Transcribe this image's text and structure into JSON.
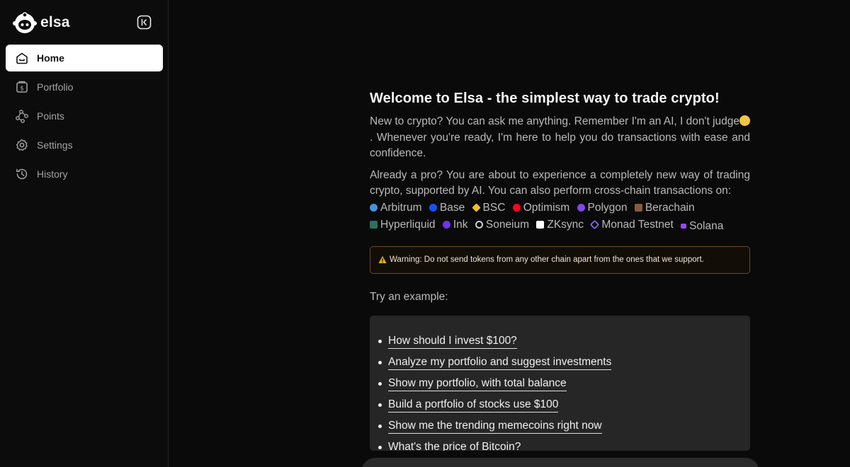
{
  "app": {
    "name": "elsa"
  },
  "sidebar": {
    "items": [
      {
        "label": "Home",
        "icon": "home-icon",
        "active": true
      },
      {
        "label": "Portfolio",
        "icon": "wallet-dollar-icon",
        "active": false
      },
      {
        "label": "Points",
        "icon": "network-nodes-icon",
        "active": false
      },
      {
        "label": "Settings",
        "icon": "gear-icon",
        "active": false
      },
      {
        "label": "History",
        "icon": "history-clock-icon",
        "active": false
      }
    ]
  },
  "main": {
    "welcome_title": "Welcome to Elsa - the simplest way to trade crypto!",
    "para1_text": "New to crypto? You can ask me anything. Remember I'm an AI, I don't judge",
    "para1_text_end": ". Whenever you're ready, I'm here to help you do transactions with ease and confidence.",
    "para2_text": "Already a pro? You are about to experience a completely new way of trading crypto, supported by AI. You can also perform cross-chain transactions on:",
    "chains": [
      {
        "name": "Arbitrum",
        "color": "#4a90d9"
      },
      {
        "name": "Base",
        "color": "#1652f0"
      },
      {
        "name": "BSC",
        "color": "#f3ba2f"
      },
      {
        "name": "Optimism",
        "color": "#ff0420"
      },
      {
        "name": "Polygon",
        "color": "#8247e5"
      },
      {
        "name": "Berachain",
        "color": "#8a5a3c"
      },
      {
        "name": "Hyperliquid",
        "color": "#2e6f5e"
      },
      {
        "name": "Ink",
        "color": "#7132f5"
      },
      {
        "name": "Soneium",
        "color": "#cccccc"
      },
      {
        "name": "ZKsync",
        "color": "#ffffff"
      },
      {
        "name": "Monad Testnet",
        "color": "#836ef9"
      },
      {
        "name": "Solana",
        "color": "#9945ff"
      }
    ],
    "warning": "Warning: Do not send tokens from any other chain apart from the ones that we support.",
    "try_label": "Try an example:",
    "examples": [
      "How should I invest $100?",
      "Analyze my portfolio and suggest investments",
      "Show my portfolio, with total balance",
      "Build a portfolio of stocks use $100",
      "Show me the trending memecoins right now",
      "What's the price of Bitcoin?"
    ]
  }
}
